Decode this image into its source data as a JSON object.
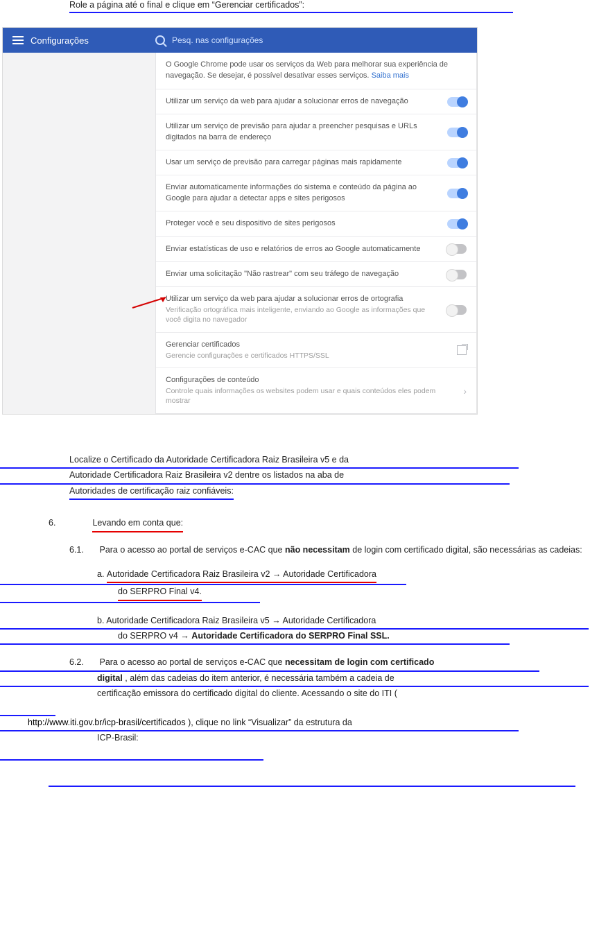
{
  "top_step_text": "Role a página até o final e clique em “Gerenciar certificados”:",
  "shot": {
    "title": "Configurações",
    "search_placeholder": "Pesq. nas configurações",
    "intro_a": "O Google Chrome pode usar os serviços da Web para melhorar sua experiência de navegação. Se desejar, é possível desativar esses serviços.",
    "intro_link": "Saiba mais",
    "rows": [
      {
        "label": "Utilizar um serviço da web para ajudar a solucionar erros de navegação",
        "state": "on"
      },
      {
        "label": "Utilizar um serviço de previsão para ajudar a preencher pesquisas e URLs digitados na barra de endereço",
        "state": "on"
      },
      {
        "label": "Usar um serviço de previsão para carregar páginas mais rapidamente",
        "state": "on"
      },
      {
        "label": "Enviar automaticamente informações do sistema e conteúdo da página ao Google para ajudar a detectar apps e sites perigosos",
        "state": "on"
      },
      {
        "label": "Proteger você e seu dispositivo de sites perigosos",
        "state": "on"
      },
      {
        "label": "Enviar estatísticas de uso e relatórios de erros ao Google automaticamente",
        "state": "off"
      },
      {
        "label": "Enviar uma solicitação \"Não rastrear\" com seu tráfego de navegação",
        "state": "off"
      },
      {
        "label": "Utilizar um serviço da web para ajudar a solucionar erros de ortografia",
        "sub": "Verificação ortográfica mais inteligente, enviando ao Google as informações que você digita no navegador",
        "state": "off"
      },
      {
        "label": "Gerenciar certificados",
        "sub": "Gerencie configurações e certificados HTTPS/SSL",
        "action": "open"
      },
      {
        "label": "Configurações de conteúdo",
        "sub": "Controle quais informações os websites podem usar e quais conteúdos eles podem mostrar",
        "action": "chev"
      }
    ]
  },
  "s1": {
    "a": " Localize o Certificado da Autoridade Certificadora Raiz Brasileira v5 e da ",
    "b": "Autoridade Certificadora Raiz Brasileira v2 dentre os listados na aba de ",
    "c": "Autoridades de certificação raiz confiáveis:"
  },
  "note": {
    "num": "6.",
    "text": "Levando em conta que:"
  },
  "bul1": {
    "num": "6.1.",
    "a": "Para o acesso ao portal de serviços e-CAC que ",
    "b": "não necessitam",
    "c": " de login com certificado digital, são necessárias as cadeias:"
  },
  "bul1a_label": "a.   ",
  "bul1a": "Autoridade Certificadora Raiz Brasileira v2 → Autoridade Certificadora ",
  "bul1a2": "do SERPRO Final v4.",
  "bul1b_label": "b.  ",
  "bul1b": "Autoridade Certificadora Raiz Brasileira v5 → Autoridade Certificadora ",
  "bul1b2": "do SERPRO v4 → ",
  "bul1b3": "Autoridade Certificadora do SERPRO Final SSL.",
  "bul2": {
    "num": "6.2.",
    "a": "Para o acesso ao portal de serviços e-CAC que ",
    "b": "necessitam de login com certificado ",
    "c": "digital",
    "d": ", além das cadeias do item anterior, é necessária também a cadeia de ",
    "e": "certificação emissora do certificado digital do cliente. Acessando o site do ITI (",
    "f": "http://www.iti.gov.br/icp-brasil/certificados",
    "g": "), clique no link “Visualizar” da estrutura da ",
    "h": "ICP-Brasil:"
  }
}
